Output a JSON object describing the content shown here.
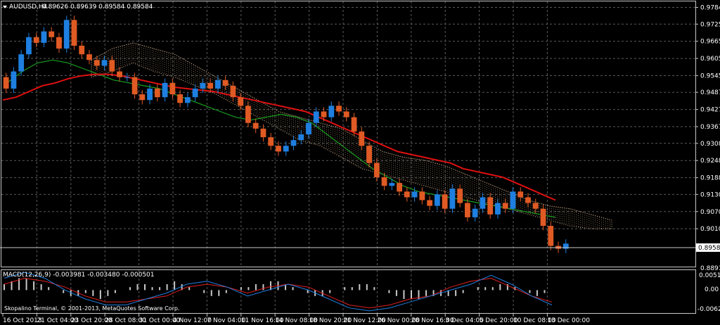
{
  "main": {
    "symbol": "AUDUSD,H4",
    "ohlc": "0.89626 0.89639 0.89584 0.89584",
    "y_ticks": [
      "0.97840",
      "0.97255",
      "0.96655",
      "0.96055",
      "0.95455",
      "0.94870",
      "0.94270",
      "0.93670",
      "0.93085",
      "0.92485",
      "0.91885",
      "0.91300",
      "0.90700",
      "0.90100"
    ],
    "bid_label": "0.89584",
    "bottom_tick": "0.88915"
  },
  "macd": {
    "label": "MACD(12,26,9) -0.003981 -0.003480 -0.000501",
    "ticks": [
      "0.005151",
      "0.00",
      "-0.006255"
    ]
  },
  "copyright": "Skopalino Terminal, © 2001-2013, MetaQuotes Software Corp.",
  "x_labels": [
    "16 Oct 2013",
    "21 Oct 04:00",
    "23 Oct 20:00",
    "28 Oct 08:00",
    "31 Oct 00:00",
    "4 Nov 12:00",
    "7 Nov 04:00",
    "11 Nov 16:00",
    "14 Nov 08:00",
    "18 Nov 20:00",
    "21 Nov 12:00",
    "26 Nov 00:00",
    "28 Nov 16:00",
    "3 Dec 04:00",
    "5 Dec 20:00",
    "10 Dec 08:00",
    "13 Dec 00:00"
  ],
  "colors": {
    "background": "#000000",
    "bull": "#1e7fe0",
    "bear": "#e05a24",
    "ma_red": "#e01010",
    "ma_green": "#18a020",
    "cloud": "#f0c8a0",
    "macd_hist": "#c8c8c8",
    "macd_signal": "#e02020",
    "macd_line": "#1e7fe0"
  },
  "chart_data": {
    "type": "candlestick",
    "price_axis_range": [
      0.888,
      0.98
    ],
    "close": [
      0.95,
      0.956,
      0.962,
      0.968,
      0.966,
      0.97,
      0.968,
      0.964,
      0.974,
      0.965,
      0.962,
      0.96,
      0.958,
      0.96,
      0.956,
      0.954,
      0.954,
      0.948,
      0.946,
      0.95,
      0.947,
      0.952,
      0.948,
      0.945,
      0.947,
      0.95,
      0.952,
      0.95,
      0.953,
      0.951,
      0.947,
      0.944,
      0.938,
      0.936,
      0.933,
      0.93,
      0.928,
      0.93,
      0.932,
      0.934,
      0.938,
      0.942,
      0.94,
      0.944,
      0.942,
      0.94,
      0.935,
      0.93,
      0.924,
      0.919,
      0.916,
      0.917,
      0.914,
      0.912,
      0.914,
      0.911,
      0.909,
      0.913,
      0.908,
      0.915,
      0.91,
      0.905,
      0.908,
      0.912,
      0.906,
      0.91,
      0.908,
      0.914,
      0.912,
      0.91,
      0.908,
      0.902,
      0.895,
      0.894,
      0.8958
    ],
    "ma_red": [
      0.946,
      0.947,
      0.949,
      0.951,
      0.952,
      0.9535,
      0.9545,
      0.955,
      0.955,
      0.9545,
      0.9535,
      0.9525,
      0.9515,
      0.9505,
      0.95,
      0.9495,
      0.949,
      0.948,
      0.947,
      0.946,
      0.945,
      0.944,
      0.943,
      0.942,
      0.94,
      0.938,
      0.936,
      0.934,
      0.932,
      0.93,
      0.928,
      0.927,
      0.926,
      0.925,
      0.924,
      0.922,
      0.921,
      0.92,
      0.919,
      0.917,
      0.915,
      0.913,
      0.911
    ],
    "ma_green": [
      0.952,
      0.956,
      0.959,
      0.96,
      0.959,
      0.957,
      0.955,
      0.953,
      0.952,
      0.951,
      0.95,
      0.948,
      0.946,
      0.944,
      0.942,
      0.94,
      0.939,
      0.94,
      0.941,
      0.94,
      0.938,
      0.934,
      0.93,
      0.926,
      0.922,
      0.919,
      0.916,
      0.914,
      0.913,
      0.912,
      0.911,
      0.91,
      0.909,
      0.908,
      0.907,
      0.906,
      0.905
    ],
    "cloud_upper": [
      0.96,
      0.964,
      0.966,
      0.964,
      0.962,
      0.958,
      0.954,
      0.95,
      0.946,
      0.942,
      0.94,
      0.938,
      0.936,
      0.932,
      0.928,
      0.926,
      0.925,
      0.923,
      0.92,
      0.917,
      0.914,
      0.911,
      0.909,
      0.908,
      0.906,
      0.904
    ],
    "cloud_lower": [
      0.954,
      0.956,
      0.959,
      0.956,
      0.954,
      0.951,
      0.948,
      0.944,
      0.94,
      0.936,
      0.932,
      0.93,
      0.926,
      0.922,
      0.92,
      0.918,
      0.916,
      0.914,
      0.912,
      0.91,
      0.908,
      0.906,
      0.904,
      0.902,
      0.901,
      0.901
    ],
    "macd_hist": [
      0.002,
      0.003,
      0.004,
      0.004,
      0.003,
      0.002,
      0.001,
      0.0,
      -0.001,
      -0.002,
      -0.002,
      -0.001,
      -0.002,
      -0.003,
      -0.002,
      -0.001,
      0.0,
      0.001,
      0.002,
      0.002,
      0.001,
      0.001,
      0.002,
      0.003,
      0.002,
      0.001,
      0.0,
      -0.001,
      -0.002,
      -0.002,
      -0.001,
      0.0,
      0.001,
      0.001,
      0.002,
      0.002,
      0.003,
      0.003,
      0.002,
      0.001,
      0.0,
      -0.001,
      -0.002,
      -0.002,
      -0.001,
      0.0,
      0.001,
      0.001,
      0.002,
      0.002,
      0.001,
      0.0,
      -0.001,
      -0.002,
      -0.003,
      -0.003,
      -0.003,
      -0.002,
      -0.002,
      -0.002,
      -0.002,
      -0.002,
      -0.001,
      0.0,
      0.001,
      0.001,
      0.001,
      0.002,
      0.002,
      0.001,
      0.0,
      -0.001,
      -0.002,
      -0.001,
      0.0
    ],
    "macd_signal": [
      0.002,
      0.004,
      0.003,
      0.001,
      -0.002,
      -0.004,
      -0.004,
      -0.003,
      -0.002,
      0.001,
      0.002,
      0.001,
      -0.001,
      0.001,
      0.002,
      0.001,
      -0.002,
      -0.005,
      -0.006,
      -0.005,
      -0.003,
      -0.002,
      0.001,
      0.003,
      0.004,
      0.001,
      -0.002,
      -0.004
    ],
    "macd_line": [
      0.004,
      0.006,
      0.004,
      0.0,
      -0.003,
      -0.005,
      -0.005,
      -0.003,
      -0.001,
      0.002,
      0.003,
      0.001,
      -0.002,
      0.0,
      0.002,
      0.0,
      -0.003,
      -0.006,
      -0.007,
      -0.006,
      -0.004,
      -0.002,
      0.0,
      0.002,
      0.005,
      0.002,
      -0.002,
      -0.005
    ],
    "macd_axis_range": [
      -0.0075,
      0.0065
    ]
  }
}
